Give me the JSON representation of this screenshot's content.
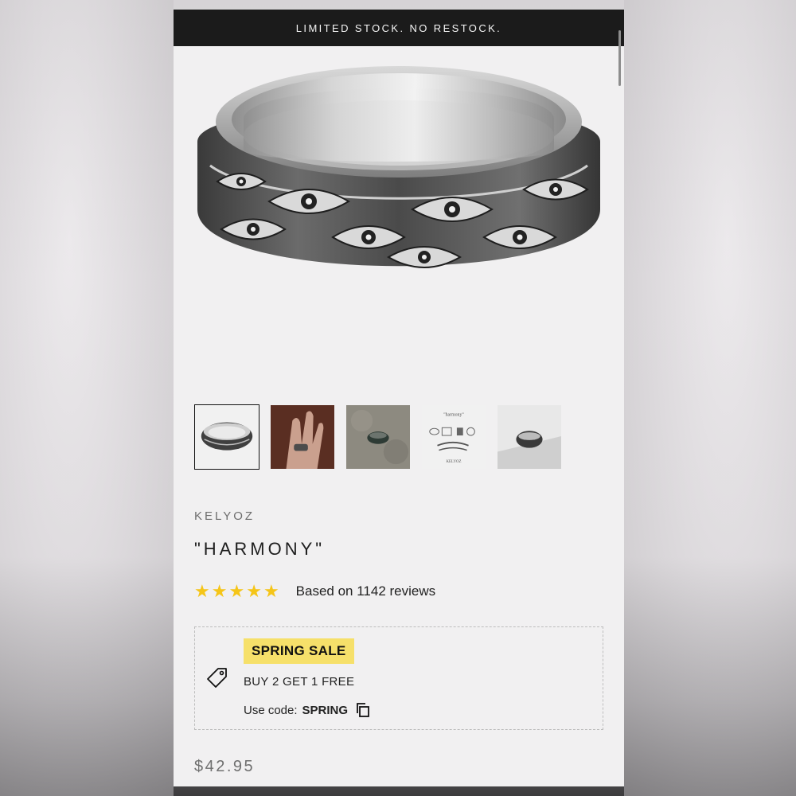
{
  "announcement": "LIMITED STOCK. NO RESTOCK.",
  "product": {
    "brand": "KELYOZ",
    "title": "\"HARMONY\"",
    "rating": {
      "stars": 5,
      "reviews_text": "Based on 1142 reviews"
    },
    "price": "$42.95"
  },
  "gallery": {
    "thumbnails": [
      {
        "name": "ring-front-view",
        "active": true
      },
      {
        "name": "ring-on-hand",
        "active": false
      },
      {
        "name": "ring-on-stone",
        "active": false
      },
      {
        "name": "ring-diagram",
        "active": false,
        "caption_top": "\"harmony\"",
        "caption_bottom": "KELYOZ"
      },
      {
        "name": "ring-studio-view",
        "active": false
      }
    ]
  },
  "promo": {
    "badge": "SPRING SALE",
    "offer": "BUY 2 GET 1 FREE",
    "code_label": "Use code:",
    "code": "SPRING",
    "icons": [
      "tag-icon",
      "copy-icon"
    ]
  },
  "colors": {
    "announce_bg": "#1b1b1b",
    "badge_bg": "#f6e06a",
    "star": "#f5c518"
  }
}
